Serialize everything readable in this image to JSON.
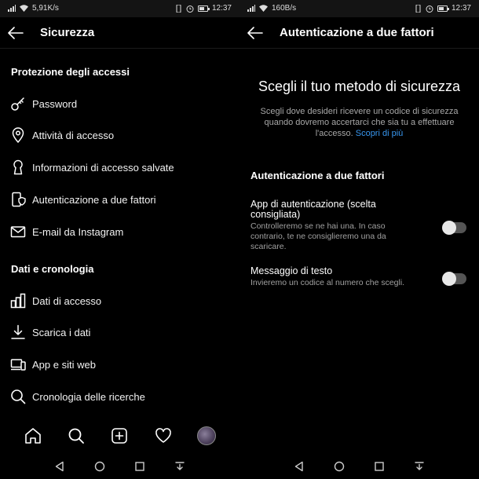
{
  "left": {
    "status": {
      "speed": "5,91K/s",
      "time": "12:37"
    },
    "header": {
      "title": "Sicurezza"
    },
    "sections": [
      {
        "title": "Protezione degli accessi",
        "items": [
          {
            "icon": "key-icon",
            "label": "Password"
          },
          {
            "icon": "location-pin-icon",
            "label": "Attività di accesso"
          },
          {
            "icon": "keyhole-icon",
            "label": "Informazioni di accesso salvate"
          },
          {
            "icon": "shield-phone-icon",
            "label": "Autenticazione a due fattori"
          },
          {
            "icon": "mail-icon",
            "label": "E-mail da Instagram"
          }
        ]
      },
      {
        "title": "Dati e cronologia",
        "items": [
          {
            "icon": "bar-chart-icon",
            "label": "Dati di accesso"
          },
          {
            "icon": "download-icon",
            "label": "Scarica i dati"
          },
          {
            "icon": "devices-icon",
            "label": "App e siti web"
          },
          {
            "icon": "search-icon",
            "label": "Cronologia delle ricerche"
          }
        ]
      }
    ]
  },
  "right": {
    "status": {
      "speed": "160B/s",
      "time": "12:37"
    },
    "header": {
      "title": "Autenticazione a due fattori"
    },
    "heading": "Scegli il tuo metodo di sicurezza",
    "description": "Scegli dove desideri ricevere un codice di sicurezza quando dovremo accertarci che sia tu a effettuare l'accesso.",
    "learn_more": "Scopri di più",
    "section_title": "Autenticazione a due fattori",
    "options": [
      {
        "title": "App di autenticazione (scelta consigliata)",
        "description": "Controlleremo se ne hai una. In caso contrario, te ne consiglieremo una da scaricare.",
        "enabled": false
      },
      {
        "title": "Messaggio di testo",
        "description": "Invieremo un codice al numero che scegli.",
        "enabled": false
      }
    ]
  }
}
